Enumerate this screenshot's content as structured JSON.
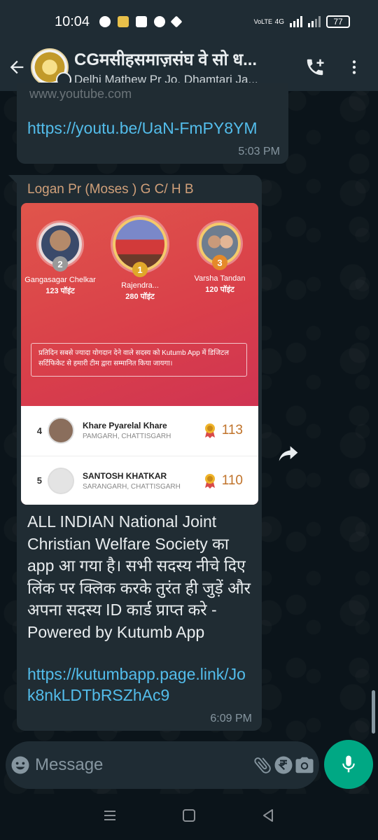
{
  "status_bar": {
    "time": "10:04",
    "network": "4G",
    "volte": "VoLTE",
    "battery": "77"
  },
  "header": {
    "title": "CGमसीहसमाज़संघ वे सो ध...",
    "subtitle": "Delhi Mathew Pr Jo, Dhamtari Ja...",
    "icons": [
      "back-arrow-icon",
      "add-call-icon",
      "more-vert-icon"
    ]
  },
  "messages": [
    {
      "faded_text": "www.youtube.com",
      "link": "https://youtu.be/UaN-FmPY8YM",
      "time": "5:03 PM"
    },
    {
      "sender": "Logan Pr (Moses ) G C/ H B",
      "card": {
        "podium": [
          {
            "rank": "2",
            "name": "Gangasagar Chelkar",
            "points": "123 पॉइंट"
          },
          {
            "rank": "1",
            "name": "Rajendra...",
            "points": "280 पॉइंट"
          },
          {
            "rank": "3",
            "name": "Varsha Tandan",
            "points": "120 पॉइंट"
          }
        ],
        "notice": "प्रतिदिन सबसे ज्यादा योगदान देने वाले सदस्य को Kutumb App में डिजिटल सर्टिफिकेट से हमारी टीम द्वारा सम्मानित किया जायगा।",
        "list": [
          {
            "rank": "4",
            "name": "Khare Pyarelal Khare",
            "location": "PAMGARH, CHATTISGARH",
            "score": "113"
          },
          {
            "rank": "5",
            "name": "SANTOSH KHATKAR",
            "location": "SARANGARH, CHATTISGARH",
            "score": "110"
          }
        ]
      },
      "text": "ALL INDIAN National Joint Christian Welfare Society का app आ गया है। सभी सदस्य नीचे दिए लिंक पर क्लिक करके तुरंत ही जुड़ें और अपना सदस्य ID कार्ड प्राप्त करे - Powered by Kutumb App",
      "link": "https://kutumbapp.page.link/Jok8nkLDTbRSZhAc9",
      "time": "6:09 PM"
    }
  ],
  "composer": {
    "placeholder": "Message",
    "icons": [
      "emoji-icon",
      "attach-icon",
      "rupee-icon",
      "camera-icon",
      "mic-icon"
    ]
  },
  "colors": {
    "accent": "#00a884",
    "link": "#53bdeb",
    "sender": "#d0a07a",
    "bubble": "#202c33",
    "bar": "#1f2c34"
  }
}
